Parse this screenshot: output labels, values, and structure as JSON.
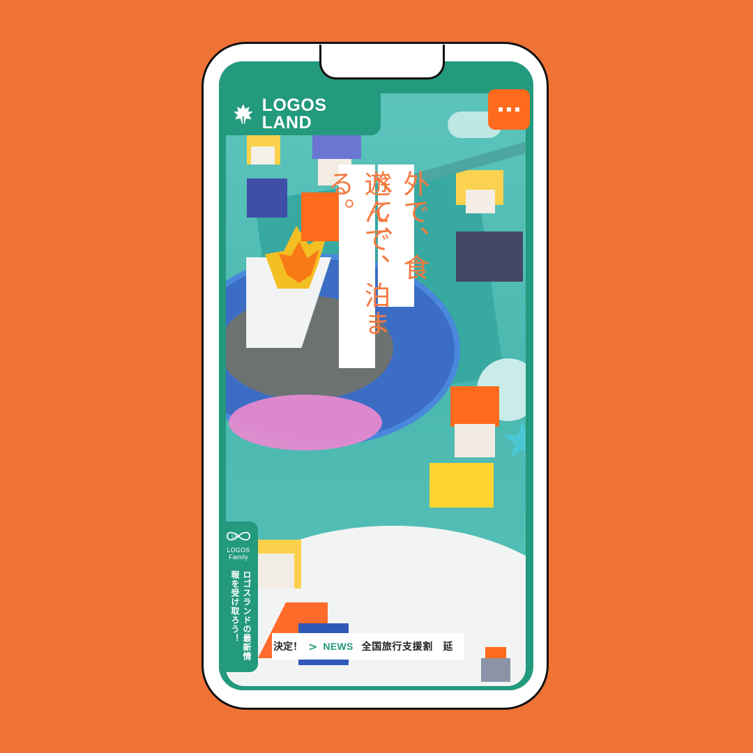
{
  "header": {
    "logo_text": "LOGOS LAND",
    "logo_icon": "maple-leaf-icon"
  },
  "menu": {
    "icon": "more-dots-icon"
  },
  "hero": {
    "tagline_column_1": "外で、食べて、",
    "tagline_column_2": "遊んで、泊まる。"
  },
  "side_tab": {
    "brand_mark": "LF",
    "brand_line_1": "LOGOS",
    "brand_line_2": "Family",
    "copy": "ロゴスランドの最新情報を受け取ろう！"
  },
  "news": {
    "previous_fragment": "決定！",
    "arrow_icon": "chevron-right-icon",
    "label": "NEWS",
    "headline": "全国旅行支援割　延"
  },
  "colors": {
    "background": "#f07336",
    "brand_green": "#23997d",
    "accent_orange": "#ff6a1d",
    "tagline_orange": "#f47a42"
  }
}
